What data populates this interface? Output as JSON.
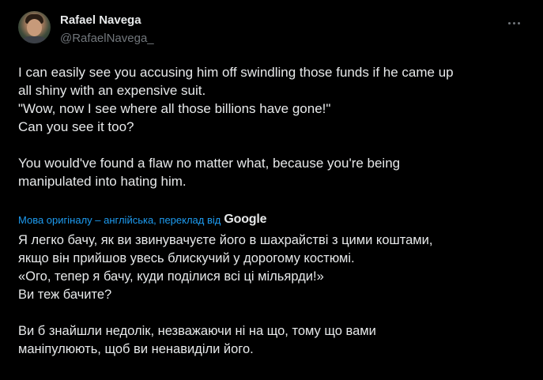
{
  "author": {
    "name": "Rafael Navega",
    "handle": "@RafaelNavega_"
  },
  "original_text": {
    "paragraph1": [
      "I can easily see you accusing him off swindling those funds if he came up",
      "all shiny with an expensive suit.",
      "\"Wow, now I see where all those billions have gone!\"",
      "Can you see it too?"
    ],
    "paragraph2": [
      "You would've found a flaw no matter what, because you're being",
      "manipulated into hating him."
    ]
  },
  "translation_note": {
    "label": "Мова оригіналу – англійська, переклад від",
    "provider": "Google",
    "color": "#1d9bf0"
  },
  "translated_text": {
    "paragraph1": [
      "Я легко бачу, як ви звинувачуєте його в шахрайстві з цими коштами,",
      "якщо він прийшов увесь блискучий у дорогому костюмі.",
      "«Ого, тепер я бачу, куди поділися всі ці мільярди!»",
      "Ви теж бачите?"
    ],
    "paragraph2": [
      "Ви б знайшли недолік, незважаючи ні на що, тому що вами",
      "маніпулюють, щоб ви ненавиділи його."
    ]
  },
  "icons": {
    "more": "more-horizontal-icon",
    "avatar": "user-avatar"
  }
}
